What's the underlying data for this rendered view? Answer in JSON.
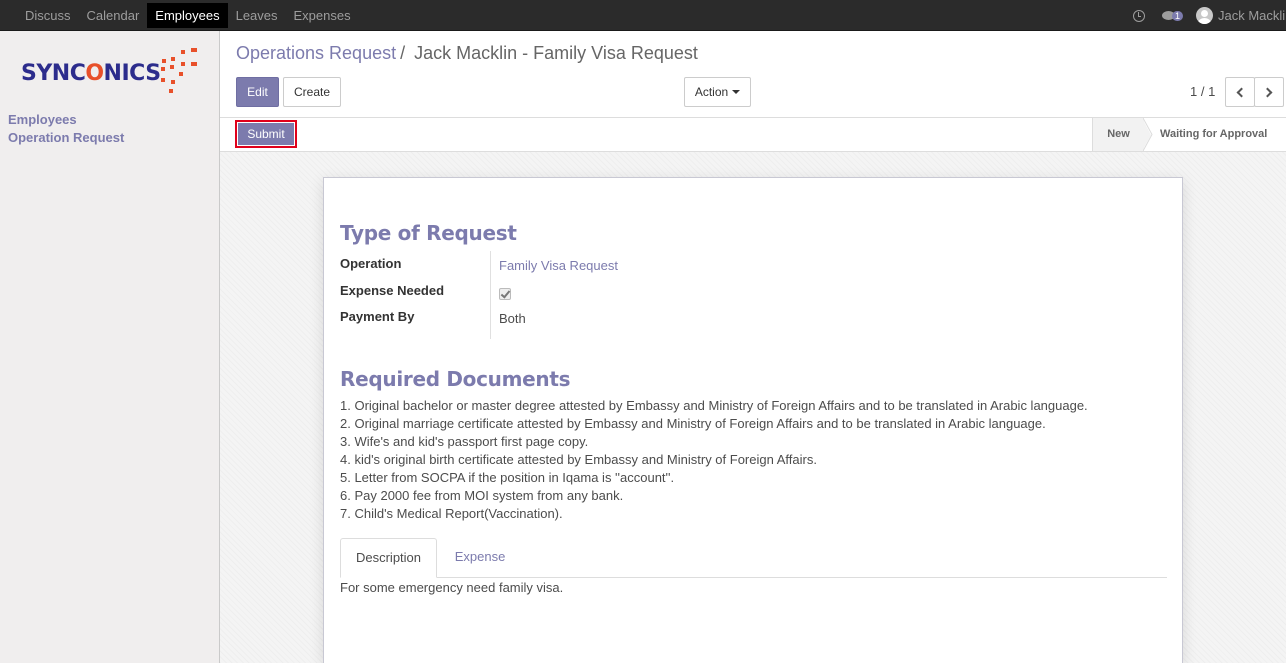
{
  "top_menu": {
    "items": [
      {
        "label": "Discuss",
        "active": false
      },
      {
        "label": "Calendar",
        "active": false
      },
      {
        "label": "Employees",
        "active": true
      },
      {
        "label": "Leaves",
        "active": false
      },
      {
        "label": "Expenses",
        "active": false
      }
    ]
  },
  "systray": {
    "messages_count": "1",
    "user_name": "Jack Macklin"
  },
  "logo": {
    "part1": "SYNC",
    "part2": "O",
    "part3": "NICS"
  },
  "sidebar": {
    "items": [
      {
        "label": "Employees"
      },
      {
        "label": "Operation Request"
      }
    ]
  },
  "breadcrumb": {
    "parent": "Operations Request",
    "separator": "/",
    "current": "Jack Macklin - Family Visa Request"
  },
  "buttons": {
    "edit": "Edit",
    "create": "Create",
    "action": "Action",
    "submit": "Submit"
  },
  "pager": {
    "value": "1 / 1"
  },
  "status": {
    "stages": [
      "New",
      "Waiting for Approval"
    ],
    "current": "New"
  },
  "form": {
    "type_heading": "Type of Request",
    "fields": {
      "operation_label": "Operation",
      "operation_value": "Family Visa Request",
      "expense_label": "Expense Needed",
      "expense_checked": true,
      "payment_label": "Payment By",
      "payment_value": "Both"
    },
    "docs_heading": "Required Documents",
    "docs": [
      "1. Original bachelor or master degree attested by Embassy and Ministry of Foreign Affairs and to be translated in Arabic language.",
      "2. Original marriage certificate attested by Embassy and Ministry of Foreign Affairs and to be translated in Arabic language.",
      "3. Wife's and kid's passport first page copy.",
      "4. kid's original birth certificate attested by Embassy and Ministry of Foreign Affairs.",
      "5. Letter from SOCPA if the position in Iqama is ''account''.",
      "6. Pay 2000 fee from MOI system from any bank.",
      "7. Child's Medical Report(Vaccination)."
    ],
    "tabs": [
      {
        "label": "Description",
        "active": true
      },
      {
        "label": "Expense",
        "active": false
      }
    ],
    "description": "For some emergency need family visa."
  },
  "colors": {
    "accent": "#7c7bad",
    "navbar": "#2b2b2b",
    "highlight_border": "#e0001b",
    "logo_blue": "#2c2c8c",
    "logo_orange": "#e8502a"
  }
}
